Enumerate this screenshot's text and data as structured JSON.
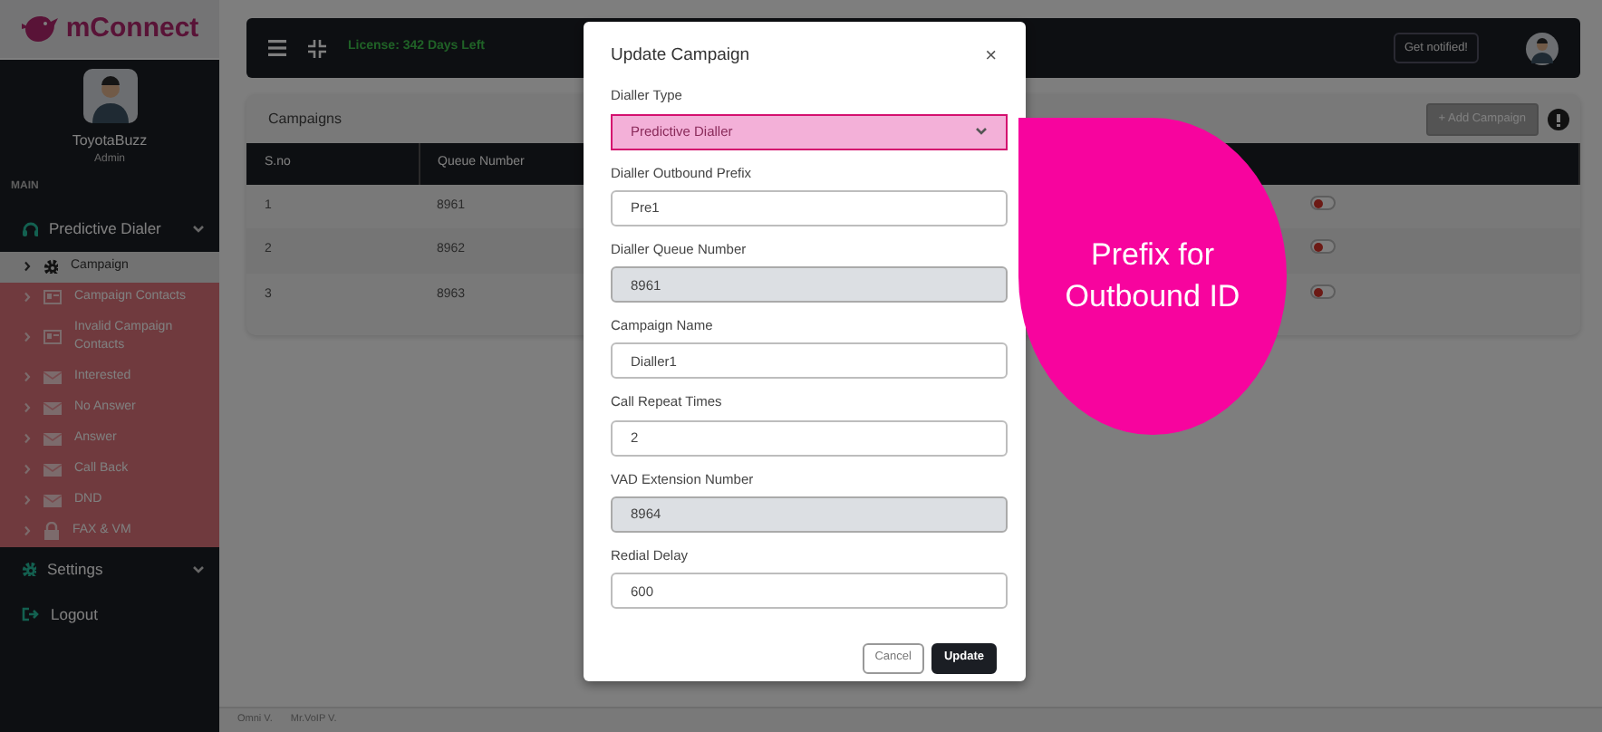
{
  "sidebar": {
    "logo": "mConnect",
    "user": {
      "name": "ToyotaBuzz",
      "role": "Admin"
    },
    "section": "MAIN",
    "items": [
      {
        "label": "Predictive Dialer",
        "expanded": true,
        "children": [
          {
            "label": "Campaign",
            "selected": true
          },
          {
            "label": "Campaign Contacts",
            "selected": false
          },
          {
            "label": "Invalid Campaign Contacts",
            "selected": false
          },
          {
            "label": "Interested",
            "selected": false
          },
          {
            "label": "No Answer",
            "selected": false
          },
          {
            "label": "Answer",
            "selected": false
          },
          {
            "label": "Call Back",
            "selected": false
          },
          {
            "label": "DND",
            "selected": false
          },
          {
            "label": "FAX & VM",
            "selected": false
          }
        ]
      },
      {
        "label": "Settings"
      },
      {
        "label": "Logout"
      }
    ]
  },
  "header": {
    "license": "License: 342 Days Left",
    "notify_button": "Get notified!"
  },
  "card": {
    "title": "Campaigns",
    "add_button": "+ Add Campaign",
    "table": {
      "columns": [
        "S.no",
        "Queue Number"
      ],
      "rows": [
        {
          "cells": [
            "1",
            "8961"
          ],
          "on": false
        },
        {
          "cells": [
            "2",
            "8962"
          ],
          "on": false
        },
        {
          "cells": [
            "3",
            "8963"
          ],
          "on": false
        }
      ]
    }
  },
  "modal": {
    "title": "Update Campaign",
    "close": "×",
    "fields": [
      {
        "label": "Dialler Type",
        "kind": "select",
        "value": "Predictive Dialler",
        "disabled": false,
        "highlighted": true
      },
      {
        "label": "Dialler Outbound Prefix",
        "kind": "input",
        "value": "Pre1",
        "disabled": false,
        "highlighted": false
      },
      {
        "label": "Dialler Queue Number",
        "kind": "input",
        "value": "8961",
        "disabled": true,
        "highlighted": false
      },
      {
        "label": "Campaign Name",
        "kind": "input",
        "value": "Dialler1",
        "disabled": false,
        "highlighted": false
      },
      {
        "label": "Call Repeat Times",
        "kind": "input",
        "value": "2",
        "disabled": false,
        "highlighted": false
      },
      {
        "label": "VAD Extension Number",
        "kind": "input",
        "value": "8964",
        "disabled": true,
        "highlighted": false
      },
      {
        "label": "Redial Delay",
        "kind": "input",
        "value": "600",
        "disabled": false,
        "highlighted": false
      }
    ],
    "buttons": [
      {
        "label": "Cancel",
        "kind": "secondary"
      },
      {
        "label": "Update",
        "kind": "primary"
      }
    ]
  },
  "callout": {
    "lines": [
      "Prefix for",
      "Outbound ID"
    ]
  },
  "footer": [
    "Omni V.",
    "Mr.VoIP V."
  ]
}
